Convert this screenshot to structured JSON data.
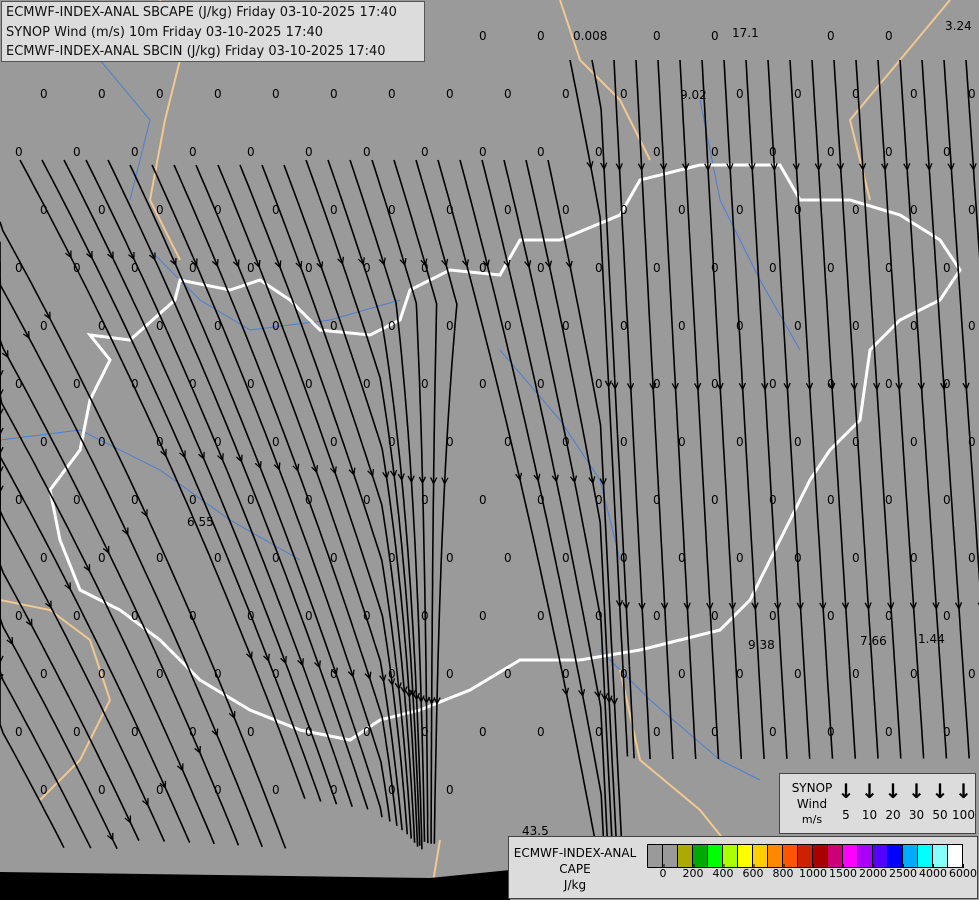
{
  "title_lines": [
    "ECMWF-INDEX-ANAL SBCAPE (J/kg) Friday 03-10-2025 17:40",
    "SYNOP Wind (m/s) 10m Friday 03-10-2025 17:40",
    "ECMWF-INDEX-ANAL SBCIN (J/kg) Friday 03-10-2025 17:40"
  ],
  "colors": {
    "background": "#9a9a9a",
    "border_country": "#ffffff",
    "border_region": "#f0c890",
    "rivers": "#4a7fd0",
    "streamlines": "#000000"
  },
  "cape_values_nonzero": [
    "0.008",
    "17.1",
    "3.24",
    "9.02",
    "6.55",
    "9.38",
    "7.66",
    "1.44",
    "43.5"
  ],
  "zero_label": "0",
  "synop_legend": {
    "label_lines": [
      "SYNOP",
      "Wind",
      "m/s"
    ],
    "speeds": [
      "5",
      "10",
      "20",
      "30",
      "50",
      "100"
    ],
    "icon": "arrow-down-icon"
  },
  "cape_legend": {
    "label_lines": [
      "ECMWF-INDEX-ANAL",
      "CAPE",
      "J/kg"
    ],
    "colors": [
      "#9a9a9a",
      "#9a9a9a",
      "#aaaa00",
      "#00aa00",
      "#00ff00",
      "#aaff00",
      "#ffff00",
      "#ffcc00",
      "#ff8800",
      "#ff5500",
      "#cc2200",
      "#aa0000",
      "#cc0077",
      "#ff00ff",
      "#aa00ff",
      "#5500ff",
      "#0000ff",
      "#00aaff",
      "#00ffff",
      "#88ffff",
      "#ffffff"
    ],
    "ticks": [
      "0",
      "200",
      "400",
      "600",
      "800",
      "1000",
      "1500",
      "2000",
      "2500",
      "4000",
      "6000"
    ]
  }
}
